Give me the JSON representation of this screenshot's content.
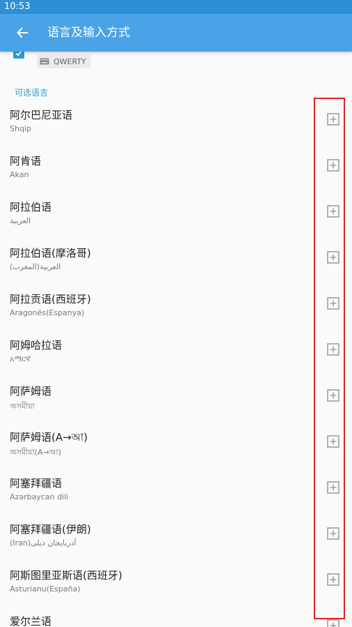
{
  "status_bar": {
    "time": "10:53"
  },
  "app_bar": {
    "title": "语言及输入方式",
    "back_icon": "arrow-left-icon"
  },
  "enabled_language": {
    "checked": true,
    "layout_label": "QWERTY",
    "keyboard_icon": "keyboard-icon"
  },
  "section_header": "可选语言",
  "languages": [
    {
      "name": "阿尔巴尼亚语",
      "native": "Shqip"
    },
    {
      "name": "阿肯语",
      "native": "Akan"
    },
    {
      "name": "阿拉伯语",
      "native": "العربية"
    },
    {
      "name": "阿拉伯语(摩洛哥)",
      "native": "العربية(المغرب)"
    },
    {
      "name": "阿拉贡语(西班牙)",
      "native": "Aragonés(Espanya)"
    },
    {
      "name": "阿姆哈拉语",
      "native": "አማርኛ"
    },
    {
      "name": "阿萨姆语",
      "native": "অসমীয়া"
    },
    {
      "name": "阿萨姆语(A→আ)",
      "native": "অসমীয়া(A→আ)"
    },
    {
      "name": "阿塞拜疆语",
      "native": "Azərbaycan dili"
    },
    {
      "name": "阿塞拜疆语(伊朗)",
      "native": "(Iran)آذربایجان دیلی"
    },
    {
      "name": "阿斯图里亚斯语(西班牙)",
      "native": "Asturianu(España)"
    },
    {
      "name": "爱尔兰语",
      "native": ""
    }
  ],
  "colors": {
    "status_bar": "#2f8fd6",
    "app_bar": "#4aa3e6",
    "accent": "#2a9bd6",
    "highlight": "#e02020"
  }
}
